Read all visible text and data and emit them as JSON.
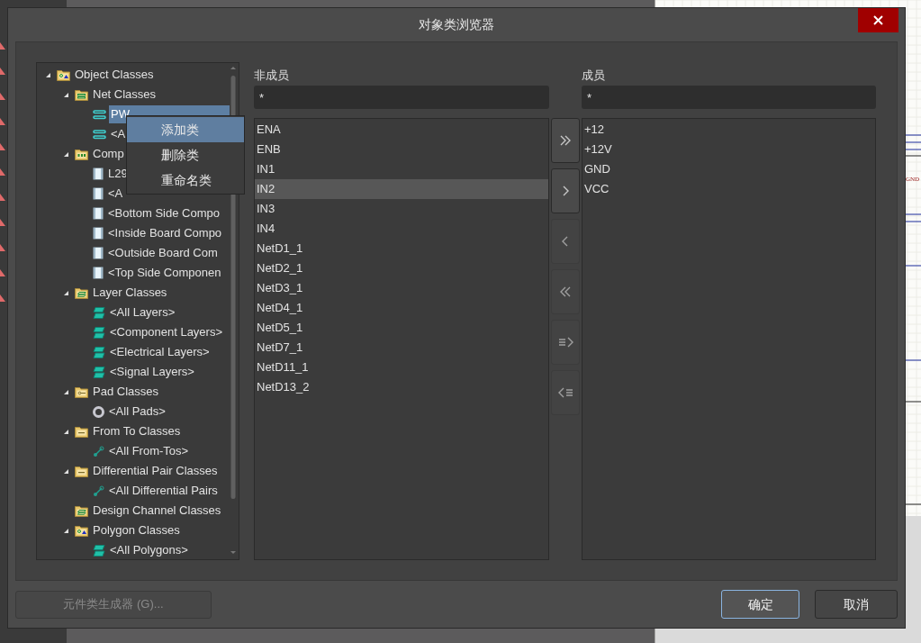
{
  "background": {
    "schematic_labels": [
      "GND"
    ]
  },
  "window": {
    "title": "对象类浏览器"
  },
  "tree": {
    "items": [
      {
        "label": "Object Classes",
        "kind": "root",
        "expanded": true,
        "selected": false,
        "children": [
          {
            "label": "Net Classes",
            "kind": "net-folder",
            "expanded": true,
            "selected": false,
            "children": [
              {
                "label": "PW",
                "kind": "net",
                "selected": true
              },
              {
                "label": "<A",
                "kind": "net",
                "selected": false
              }
            ]
          },
          {
            "label": "Comp",
            "kind": "component-folder",
            "expanded": true,
            "selected": false,
            "children": [
              {
                "label": "L29",
                "kind": "component",
                "selected": false
              },
              {
                "label": "<A",
                "kind": "component",
                "selected": false
              },
              {
                "label": "<Bottom Side Compo",
                "kind": "component",
                "selected": false
              },
              {
                "label": "<Inside Board Compo",
                "kind": "component",
                "selected": false
              },
              {
                "label": "<Outside Board Com",
                "kind": "component",
                "selected": false
              },
              {
                "label": "<Top Side Componen",
                "kind": "component",
                "selected": false
              }
            ]
          },
          {
            "label": "Layer Classes",
            "kind": "layer-folder",
            "expanded": true,
            "selected": false,
            "children": [
              {
                "label": "<All Layers>",
                "kind": "layer",
                "selected": false
              },
              {
                "label": "<Component Layers>",
                "kind": "layer",
                "selected": false
              },
              {
                "label": "<Electrical Layers>",
                "kind": "layer",
                "selected": false
              },
              {
                "label": "<Signal Layers>",
                "kind": "layer",
                "selected": false
              }
            ]
          },
          {
            "label": "Pad Classes",
            "kind": "pad-folder",
            "expanded": true,
            "selected": false,
            "children": [
              {
                "label": "<All Pads>",
                "kind": "pad",
                "selected": false
              }
            ]
          },
          {
            "label": "From To Classes",
            "kind": "link-folder",
            "expanded": true,
            "selected": false,
            "children": [
              {
                "label": "<All From-Tos>",
                "kind": "link",
                "selected": false
              }
            ]
          },
          {
            "label": "Differential Pair Classes",
            "kind": "link-folder",
            "expanded": true,
            "selected": false,
            "children": [
              {
                "label": "<All Differential Pairs",
                "kind": "link",
                "selected": false
              }
            ]
          },
          {
            "label": "Design Channel Classes",
            "kind": "layer-folder",
            "selected": false
          },
          {
            "label": "Polygon Classes",
            "kind": "root",
            "expanded": true,
            "selected": false,
            "children": [
              {
                "label": "<All Polygons>",
                "kind": "layer",
                "selected": false
              }
            ]
          }
        ]
      }
    ]
  },
  "context_menu": [
    {
      "label": "添加类",
      "selected": true
    },
    {
      "label": "删除类",
      "selected": false
    },
    {
      "label": "重命名类",
      "selected": false
    }
  ],
  "non_members": {
    "label": "非成员",
    "filter": "*",
    "items": [
      {
        "label": "ENA",
        "selected": false
      },
      {
        "label": "ENB",
        "selected": false
      },
      {
        "label": "IN1",
        "selected": false
      },
      {
        "label": "IN2",
        "selected": true
      },
      {
        "label": "IN3",
        "selected": false
      },
      {
        "label": "IN4",
        "selected": false
      },
      {
        "label": "NetD1_1",
        "selected": false
      },
      {
        "label": "NetD2_1",
        "selected": false
      },
      {
        "label": "NetD3_1",
        "selected": false
      },
      {
        "label": "NetD4_1",
        "selected": false
      },
      {
        "label": "NetD5_1",
        "selected": false
      },
      {
        "label": "NetD7_1",
        "selected": false
      },
      {
        "label": "NetD11_1",
        "selected": false
      },
      {
        "label": "NetD13_2",
        "selected": false
      }
    ]
  },
  "transfer_buttons": [
    {
      "kind": "add-all",
      "disabled": false
    },
    {
      "kind": "add",
      "disabled": false
    },
    {
      "kind": "remove",
      "disabled": true
    },
    {
      "kind": "remove-all",
      "disabled": true
    },
    {
      "kind": "add-list",
      "disabled": true
    },
    {
      "kind": "remove-list",
      "disabled": true
    }
  ],
  "members": {
    "label": "成员",
    "filter": "*",
    "items": [
      {
        "label": "+12",
        "selected": false
      },
      {
        "label": "+12V",
        "selected": false
      },
      {
        "label": "GND",
        "selected": false
      },
      {
        "label": "VCC",
        "selected": false
      }
    ]
  },
  "footer": {
    "generator_button": {
      "label": "元件类生成器 (G)...",
      "disabled": true
    },
    "ok": "确定",
    "cancel": "取消"
  }
}
